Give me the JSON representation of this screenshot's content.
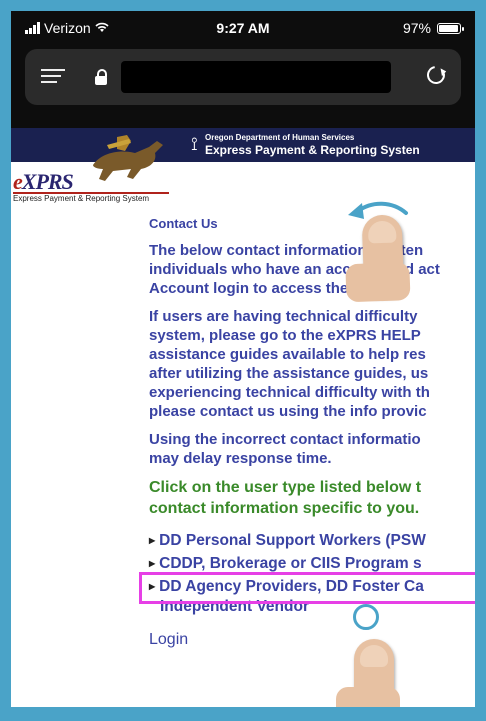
{
  "status_bar": {
    "carrier": "Verizon",
    "time": "9:27 AM",
    "battery_percent": "97%",
    "battery_level": 0.97
  },
  "browser": {
    "url": ""
  },
  "site": {
    "agency": "Oregon Department of Human Services",
    "system_title": "Express Payment & Reporting Systen",
    "logo_text_e": "e",
    "logo_text_rest": "XPRS",
    "logo_subtitle": "Express Payment & Reporting System"
  },
  "content": {
    "heading": "Contact Us",
    "para1_lines": [
      "The below contact information is inten",
      "individuals who have an account and act",
      "Account login to access the system."
    ],
    "para2_lines": [
      "If users are having technical difficulty",
      "system, please go to the eXPRS HELP",
      "assistance guides available to help res",
      "after utilizing the assistance guides, us",
      "experiencing technical difficulty with th",
      "please contact us using the info provic"
    ],
    "para3_lines": [
      "Using the incorrect contact informatio",
      "may delay response time."
    ],
    "instruction_lines": [
      "Click on the user type listed below t",
      "contact information specific to you."
    ],
    "links": [
      {
        "label": "DD Personal Support Workers (PSW"
      },
      {
        "label": "CDDP, Brokerage or CIIS Program s"
      },
      {
        "label": "DD Agency Providers, DD Foster Ca",
        "label2": "Independent Vendor"
      }
    ],
    "login": "Login"
  },
  "colors": {
    "frame": "#4aa3c8",
    "text_blue": "#3a43a3",
    "text_green": "#3a8a2a",
    "highlight": "#e63fe6"
  }
}
